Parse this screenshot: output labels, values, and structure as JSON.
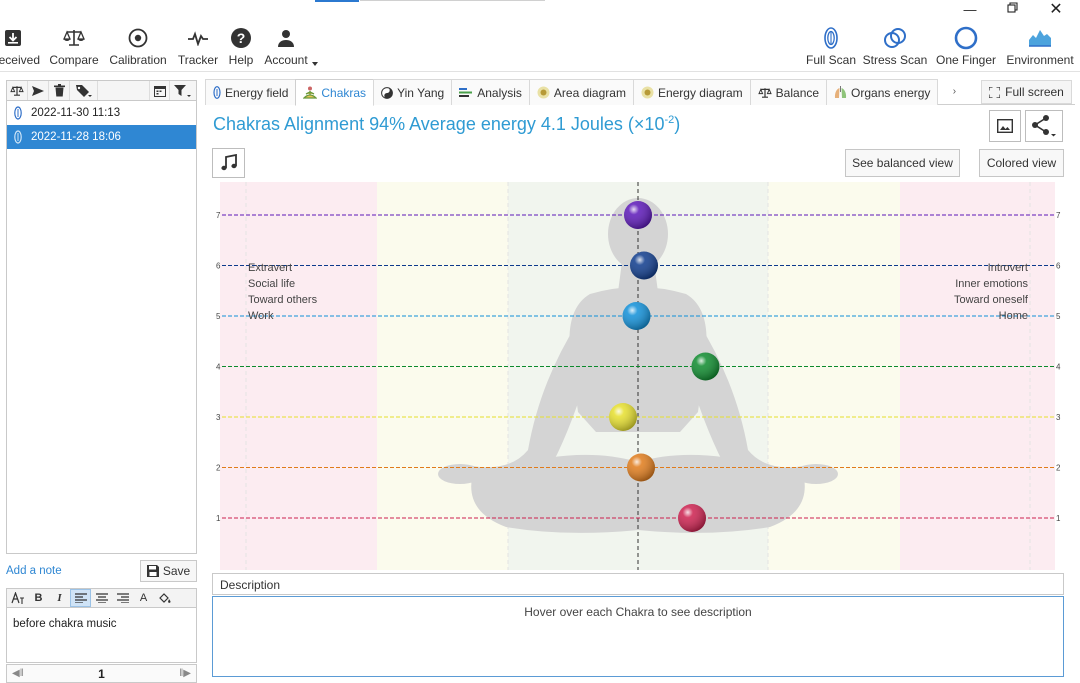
{
  "toolbar": {
    "left_items": [
      {
        "label": "eceived",
        "icon": "download-box-icon"
      },
      {
        "label": "Compare",
        "icon": "scale-icon"
      },
      {
        "label": "Calibration",
        "icon": "target-icon"
      },
      {
        "label": "Tracker",
        "icon": "pulse-icon"
      },
      {
        "label": "Help",
        "icon": "help-icon"
      },
      {
        "label": "Account",
        "icon": "user-icon"
      }
    ],
    "right_items": [
      {
        "label": "Full Scan",
        "icon": "finger-scan-icon"
      },
      {
        "label": "Stress Scan",
        "icon": "rings-icon"
      },
      {
        "label": "One Finger",
        "icon": "circle-icon"
      },
      {
        "label": "Environment",
        "icon": "landscape-icon"
      }
    ]
  },
  "sessions": {
    "items": [
      {
        "label": "2022-11-30 11:13",
        "selected": false
      },
      {
        "label": "2022-11-28 18:06",
        "selected": true
      }
    ]
  },
  "notes": {
    "add_label": "Add a note",
    "save_label": "Save",
    "text": "before chakra music",
    "page": "1"
  },
  "tabs": [
    {
      "label": "Energy field",
      "icon": "finger-icon",
      "active": false
    },
    {
      "label": "Chakras",
      "icon": "meditation-icon",
      "active": true
    },
    {
      "label": "Yin Yang",
      "icon": "yin-yang-icon",
      "active": false
    },
    {
      "label": "Analysis",
      "icon": "bars-icon",
      "active": false
    },
    {
      "label": "Area diagram",
      "icon": "sun-icon",
      "active": false
    },
    {
      "label": "Energy diagram",
      "icon": "sun-icon",
      "active": false
    },
    {
      "label": "Balance",
      "icon": "scale-icon",
      "active": false
    },
    {
      "label": "Organs energy",
      "icon": "lungs-icon",
      "active": false
    }
  ],
  "fullscreen_label": "Full screen",
  "heading": {
    "text": "Chakras Alignment 94% Average energy 4.1 Joules (×10",
    "exponent": "-2",
    "close": ")"
  },
  "buttons": {
    "balanced": "See balanced view",
    "colored": "Colored view"
  },
  "chart_data": {
    "type": "scatter",
    "y_ticks": [
      "1",
      "2",
      "3",
      "4",
      "5",
      "6",
      "7"
    ],
    "left_labels": [
      "Extravert",
      "Social life",
      "Toward others",
      "Work"
    ],
    "right_labels": [
      "Introvert",
      "Inner emotions",
      "Toward oneself",
      "Home"
    ],
    "zones": [
      "#fcecf1",
      "#fbfbed",
      "#f1f5ee",
      "#fbfbed",
      "#fcecf1"
    ],
    "chakras": [
      {
        "level": 7,
        "offset": 0.0,
        "color": "#5b16b8"
      },
      {
        "level": 6,
        "offset": 0.2,
        "color": "#0d3a8c"
      },
      {
        "level": 5,
        "offset": -0.05,
        "color": "#0f8fd8"
      },
      {
        "level": 4,
        "offset": 2.25,
        "color": "#0c8a2c"
      },
      {
        "level": 3,
        "offset": -0.5,
        "color": "#e6df2c"
      },
      {
        "level": 2,
        "offset": 0.1,
        "color": "#e07b1a"
      },
      {
        "level": 1,
        "offset": 1.8,
        "color": "#cc1f4e"
      }
    ]
  },
  "description": {
    "title": "Description",
    "hint": "Hover over each Chakra to see description"
  }
}
